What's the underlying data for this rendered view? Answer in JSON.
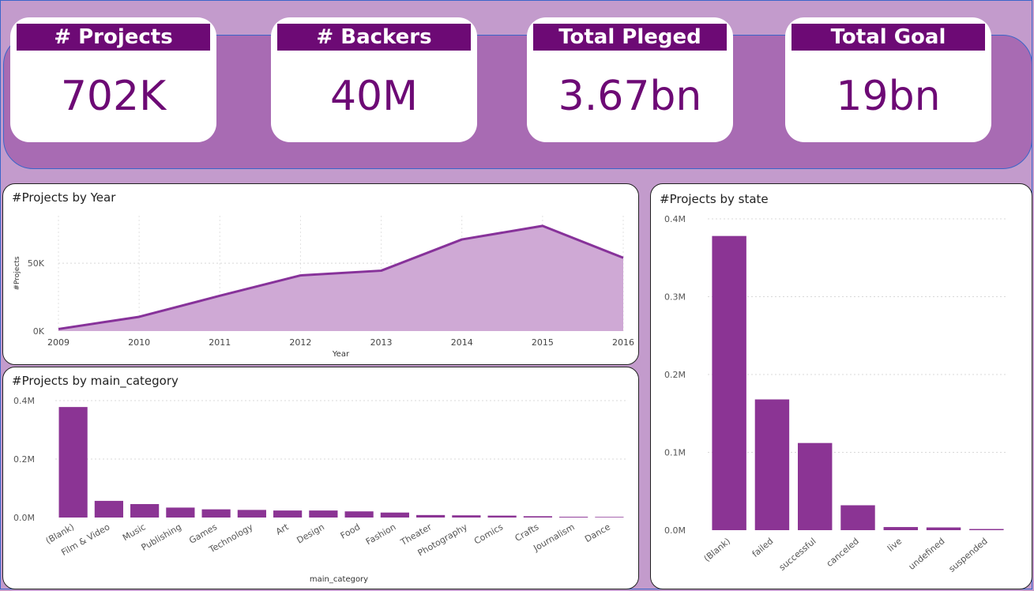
{
  "colors": {
    "background": "#c39bcc",
    "band": "#a86bb3",
    "accent": "#6d0a75",
    "bar": "#8b3494",
    "line": "#87329a",
    "area": "#cfa9d5"
  },
  "kpis": [
    {
      "title": "# Projects",
      "value": "702K"
    },
    {
      "title": "# Backers",
      "value": "40M"
    },
    {
      "title": "Total Pleged",
      "value": "3.67bn"
    },
    {
      "title": "Total Goal",
      "value": "19bn"
    }
  ],
  "panels": {
    "year": {
      "title": "#Projects by Year"
    },
    "category": {
      "title": "#Projects by main_category"
    },
    "state": {
      "title": "#Projects by state"
    }
  },
  "chart_data": [
    {
      "id": "year",
      "type": "area",
      "title": "#Projects by Year",
      "xlabel": "Year",
      "ylabel": "#Projects",
      "x": [
        "2009",
        "2010",
        "2011",
        "2012",
        "2013",
        "2014",
        "2015",
        "2016"
      ],
      "values": [
        1500,
        10500,
        26000,
        41000,
        44500,
        67500,
        77500,
        54000
      ],
      "ylim": [
        0,
        85000
      ],
      "yticks": [
        {
          "v": 0,
          "label": "0K"
        },
        {
          "v": 50000,
          "label": "50K"
        }
      ],
      "grid": true
    },
    {
      "id": "category",
      "type": "bar",
      "title": "#Projects by main_category",
      "xlabel": "main_category",
      "ylabel": "",
      "categories": [
        "(Blank)",
        "Film & Video",
        "Music",
        "Publishing",
        "Games",
        "Technology",
        "Art",
        "Design",
        "Food",
        "Fashion",
        "Theater",
        "Photography",
        "Comics",
        "Crafts",
        "Journalism",
        "Dance"
      ],
      "values": [
        378000,
        57000,
        46000,
        34000,
        28000,
        26000,
        24000,
        24000,
        21000,
        17000,
        8500,
        7500,
        6500,
        4500,
        2500,
        2000
      ],
      "ylim": [
        0,
        400000
      ],
      "yticks": [
        {
          "v": 0,
          "label": "0.0M"
        },
        {
          "v": 200000,
          "label": "0.2M"
        },
        {
          "v": 400000,
          "label": "0.4M"
        }
      ],
      "grid": true
    },
    {
      "id": "state",
      "type": "bar",
      "title": "#Projects by state",
      "xlabel": "",
      "ylabel": "",
      "categories": [
        "(Blank)",
        "failed",
        "successful",
        "canceled",
        "live",
        "undefined",
        "suspended"
      ],
      "values": [
        378000,
        168000,
        112000,
        32000,
        4000,
        3500,
        1500
      ],
      "ylim": [
        0,
        400000
      ],
      "yticks": [
        {
          "v": 0,
          "label": "0.0M"
        },
        {
          "v": 100000,
          "label": "0.1M"
        },
        {
          "v": 200000,
          "label": "0.2M"
        },
        {
          "v": 300000,
          "label": "0.3M"
        },
        {
          "v": 400000,
          "label": "0.4M"
        }
      ],
      "grid": true
    }
  ]
}
